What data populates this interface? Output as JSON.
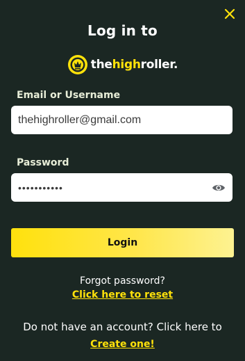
{
  "title": "Log in to",
  "brand": {
    "prefix": "the",
    "highlight": "high",
    "suffix": "roller.",
    "logo_icon": "highroller-logo-icon",
    "accent_color": "#ffe20a"
  },
  "close": {
    "icon": "close-icon",
    "color": "#ffe20a"
  },
  "email": {
    "label": "Email or Username",
    "value": "thehighroller@gmail.com"
  },
  "password": {
    "label": "Password",
    "value": "•••••••••••",
    "toggle_icon": "eye-icon"
  },
  "login_label": "Login",
  "forgot": {
    "text": "Forgot password?",
    "link": "Click here to reset"
  },
  "signup": {
    "text": "Do not have an account? Click here to",
    "link": "Create one!"
  },
  "colors": {
    "background": "#1b2723",
    "button_gradient_start": "#ffe10d",
    "button_gradient_end": "#fdf291"
  }
}
